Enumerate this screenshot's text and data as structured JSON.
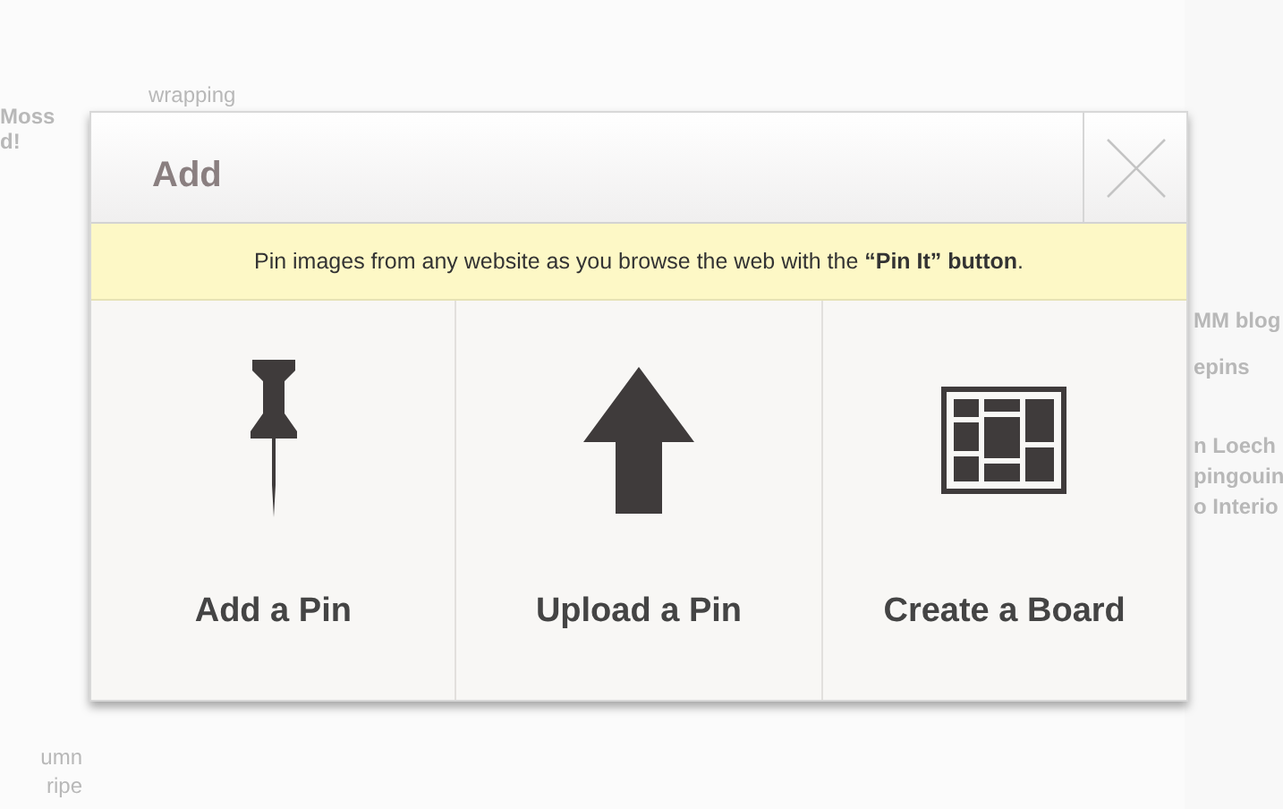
{
  "background": {
    "left_texts": [
      "Moss",
      "d!",
      "umn",
      "ripe"
    ],
    "main_texts": [
      "wrapping"
    ],
    "right_texts": [
      "MM blog",
      "epins",
      "n Loech",
      "pingouin",
      "o Interio"
    ]
  },
  "dialog": {
    "title": "Add",
    "notice": "Pin images from any website as you browse the web with the **“Pin It” button**.",
    "options": [
      {
        "kind": "pin",
        "label": "Add a Pin"
      },
      {
        "kind": "upload",
        "label": "Upload a Pin"
      },
      {
        "kind": "board",
        "label": "Create a Board"
      }
    ]
  }
}
